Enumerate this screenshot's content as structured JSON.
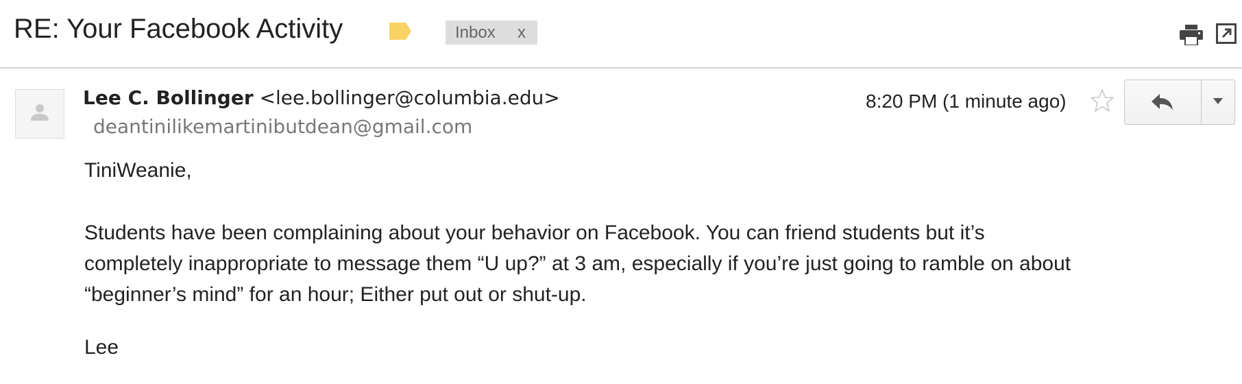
{
  "email": {
    "subject": "RE: Your Facebook Activity",
    "label_chip": {
      "text": "Inbox",
      "close": "x"
    },
    "header_icons": [
      "label-tag-icon",
      "print-icon",
      "open-in-new-window-icon"
    ],
    "sender": {
      "name": "Lee C. Bollinger",
      "address": "<lee.bollinger@columbia.edu>"
    },
    "recipient": "deantinilikemartinibutdean@gmail.com",
    "timestamp": "8:20 PM (1 minute ago)",
    "action_icons": [
      "star-icon",
      "reply-icon",
      "more-options-icon"
    ],
    "body": {
      "greeting": "TiniWeanie,",
      "paragraph_lines": [
        "Students have been complaining about your behavior on Facebook. You can friend students but it’s",
        "completely inappropriate to message them “U up?” at 3 am, especially if you’re just going to ramble on about",
        "“beginner’s mind” for an hour; Either put out or shut-up."
      ],
      "signoff": "Lee"
    }
  },
  "colors": {
    "label_tag": "#fad165",
    "chip_bg": "#dddddd",
    "divider": "#d6d6d6",
    "muted_text": "#777777"
  }
}
